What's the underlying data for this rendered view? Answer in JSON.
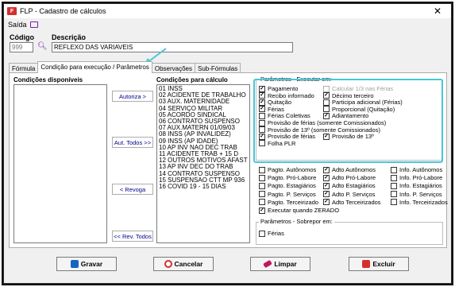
{
  "window": {
    "title": "FLP - Cadastro de cálculos",
    "close": "✕"
  },
  "menu": {
    "saida": "Saída"
  },
  "codigo": {
    "label": "Código",
    "value": "999"
  },
  "descricao": {
    "label": "Descrição",
    "value": "REFLEXO DAS VARIAVEIS"
  },
  "tabs": [
    {
      "label": "Fórmula"
    },
    {
      "label": "Condição para execução / Parâmetros"
    },
    {
      "label": "Observações"
    },
    {
      "label": "Sub-Fórmulas"
    }
  ],
  "left_panel": {
    "title": "Condições disponíveis"
  },
  "right_panel": {
    "title": "Condições para cálculo",
    "items": [
      "01 INSS",
      "02 ACIDENTE DE TRABALHO",
      "03 AUX. MATERNIDADE",
      "04 SERVIÇO MILITAR",
      "05 ACORDO SINDICAL",
      "06 CONTRATO SUSPENSO",
      "07 AUX.MATERN  01/09/03",
      "08 INSS (AP INVALIDEZ)",
      "09 INSS (AP IDADE)",
      "10 AP INV NAO DEC TRAB",
      "11 ACIDENTE TRAB + 15 D",
      "12 OUTROS MOTIVOS AFAST",
      "13 AP INV DEC DO TRAB",
      "14 CONTRATO SUSPENSO",
      "15 SUSPENSAO CTT MP 936",
      "16 COVID 19 - 15 DIAS"
    ]
  },
  "buttons": {
    "autoriza": "Autoriza >",
    "aut_todos": "Aut. Todos >>",
    "revoga": "< Revoga",
    "rev_todos": "<< Rev. Todos"
  },
  "params": {
    "title": "Parâmetros - Executar em:",
    "items": [
      {
        "label": "Pagamento",
        "checked": true,
        "disabled": false
      },
      {
        "label": "Calcular 1/3 nas Férias",
        "checked": false,
        "disabled": true
      },
      {
        "label": "Recibo informado",
        "checked": true,
        "disabled": false
      },
      {
        "label": "Décimo terceiro",
        "checked": true,
        "disabled": false
      },
      {
        "label": "Quitação",
        "checked": true,
        "disabled": false
      },
      {
        "label": "Participa adicional (Férias)",
        "checked": false,
        "disabled": false
      },
      {
        "label": "Férias",
        "checked": true,
        "disabled": false
      },
      {
        "label": "Proporcional (Quitação)",
        "checked": false,
        "disabled": false
      },
      {
        "label": "Férias Coletivas",
        "checked": false,
        "disabled": false
      },
      {
        "label": "Adiantamento",
        "checked": true,
        "disabled": false
      },
      {
        "label": "Provisão de férias (somente Comissionados)",
        "checked": false,
        "disabled": false
      },
      {
        "label": "Provisão de 13º (somente Comissionados)",
        "checked": false,
        "disabled": false
      },
      {
        "label": "Provisão de férias",
        "checked": true,
        "disabled": false
      },
      {
        "label": "Provisão de 13º",
        "checked": true,
        "disabled": false
      },
      {
        "label": "Folha PLR",
        "checked": false,
        "disabled": false
      }
    ]
  },
  "extras": [
    {
      "label": "Pagto. Autônomos",
      "checked": false
    },
    {
      "label": "Adto Autônomos",
      "checked": true
    },
    {
      "label": "Info. Autônomos",
      "checked": false
    },
    {
      "label": "Pagto. Pró-Labore",
      "checked": false
    },
    {
      "label": "Adto Pró-Labore",
      "checked": true
    },
    {
      "label": "Info. Pró-Labore",
      "checked": false
    },
    {
      "label": "Pagto. Estagiários",
      "checked": false
    },
    {
      "label": "Adto Estagiários",
      "checked": true
    },
    {
      "label": "Info. Estagiários",
      "checked": false
    },
    {
      "label": "Pagto. P. Serviços",
      "checked": false
    },
    {
      "label": "Adto P. Serviços",
      "checked": true
    },
    {
      "label": "Info. P. Serviços",
      "checked": false
    },
    {
      "label": "Pagto. Terceirizado",
      "checked": false
    },
    {
      "label": "Adto Terceirizados",
      "checked": true
    },
    {
      "label": "Info. Terceirizados",
      "checked": false
    }
  ],
  "zerado": {
    "label": "Executar quando ZERADO",
    "checked": true
  },
  "sobrepor": {
    "title": "Parâmetros - Sobrepor em:",
    "ferias": "Férias",
    "checked": false
  },
  "footer": {
    "gravar": "Gravar",
    "cancelar": "Cancelar",
    "limpar": "Limpar",
    "excluir": "Excluir"
  },
  "colors": {
    "highlight": "#48c7d8",
    "accent_purple": "#7b1fa2"
  },
  "icons": {
    "save": "save-icon",
    "cancel": "cancel-icon",
    "clear": "eraser-icon",
    "delete": "trash-icon"
  }
}
